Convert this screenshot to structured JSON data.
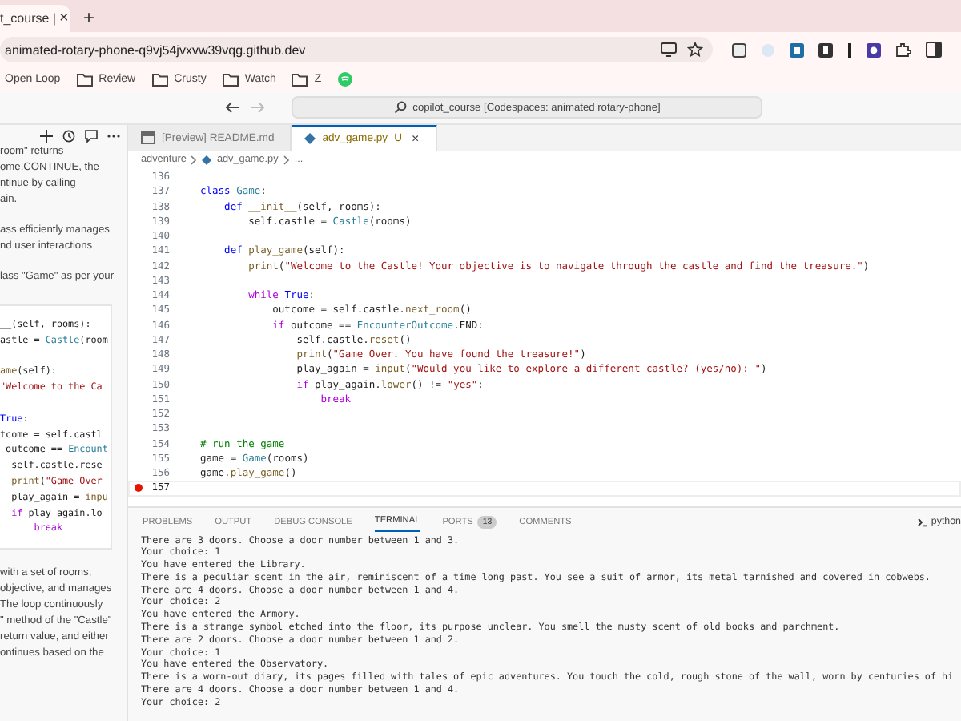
{
  "browser": {
    "tab": {
      "title": "t_course |",
      "close": "×"
    },
    "new_tab": "+",
    "url": "animated-rotary-phone-q9vj54jvxvw39vqg.github.dev",
    "bookmarks": [
      {
        "label": "Open Loop",
        "kind": "link"
      },
      {
        "label": "Review",
        "kind": "folder"
      },
      {
        "label": "Crusty",
        "kind": "folder"
      },
      {
        "label": "Watch",
        "kind": "folder"
      },
      {
        "label": "Z",
        "kind": "folder"
      },
      {
        "kind": "app"
      }
    ]
  },
  "title_bar": {
    "command_center": "copilot_course [Codespaces: animated rotary-phone]"
  },
  "chat": {
    "paragraphs_top": [
      [
        "room\" returns",
        "ome.CONTINUE, the",
        "ntinue by calling",
        "ain."
      ],
      [
        "ass efficiently manages",
        "nd user interactions"
      ],
      [
        "lass \"Game\" as per your"
      ]
    ],
    "code": [
      {
        "kind": "code",
        "tokens": [
          {
            "text": "__(self, rooms):",
            "kind": "plain"
          }
        ]
      },
      {
        "kind": "code",
        "tokens": [
          {
            "text": "astle = ",
            "kind": "plain"
          },
          {
            "text": "Castle",
            "kind": "class"
          },
          {
            "text": "(room",
            "kind": "plain"
          }
        ]
      },
      {
        "kind": "blank"
      },
      {
        "kind": "code",
        "tokens": [
          {
            "text": "ame",
            "kind": "function"
          },
          {
            "text": "(self):",
            "kind": "plain"
          }
        ]
      },
      {
        "kind": "code",
        "tokens": [
          {
            "text": "\"Welcome to the Ca",
            "kind": "string"
          }
        ]
      },
      {
        "kind": "blank"
      },
      {
        "kind": "code",
        "tokens": [
          {
            "text": "True",
            "kind": "keyword"
          },
          {
            "text": ":",
            "kind": "plain"
          }
        ]
      },
      {
        "kind": "code",
        "tokens": [
          {
            "text": "tcome = self.castl",
            "kind": "plain"
          }
        ]
      },
      {
        "kind": "code",
        "tokens": [
          {
            "text": " outcome == ",
            "kind": "plain"
          },
          {
            "text": "Encount",
            "kind": "class"
          }
        ]
      },
      {
        "kind": "code",
        "tokens": [
          {
            "text": "  self.castle.rese",
            "kind": "plain"
          }
        ]
      },
      {
        "kind": "code",
        "tokens": [
          {
            "text": "  print",
            "kind": "function"
          },
          {
            "text": "(",
            "kind": "plain"
          },
          {
            "text": "\"Game Over",
            "kind": "string"
          }
        ]
      },
      {
        "kind": "code",
        "tokens": [
          {
            "text": "  play_again = ",
            "kind": "plain"
          },
          {
            "text": "inpu",
            "kind": "function"
          }
        ]
      },
      {
        "kind": "code",
        "tokens": [
          {
            "text": "  if",
            "kind": "control"
          },
          {
            "text": " play_again.lo",
            "kind": "plain"
          }
        ]
      },
      {
        "kind": "code",
        "tokens": [
          {
            "text": "      break",
            "kind": "control"
          }
        ]
      }
    ],
    "paragraphs_bottom": [
      [
        "with a set of rooms,",
        "objective, and manages",
        "The loop continuously",
        "\" method of the \"Castle\"",
        "return value, and either",
        "ontinues based on the"
      ]
    ]
  },
  "editor": {
    "tabs": [
      {
        "label": "[Preview] README.md",
        "kind": "preview",
        "selected": false
      },
      {
        "label": "adv_game.py",
        "kind": "python",
        "status": "U",
        "close": "×",
        "selected": true
      }
    ],
    "breadcrumb": [
      "adventure",
      "adv_game.py",
      "..."
    ],
    "lines": [
      {
        "number": "136"
      },
      {
        "number": "137",
        "tokens": [
          {
            "text": "class ",
            "kind": "keyword"
          },
          {
            "text": "Game",
            "kind": "class"
          },
          {
            "text": ":",
            "kind": "plain"
          }
        ]
      },
      {
        "number": "138",
        "tokens": [
          {
            "text": "    def ",
            "kind": "keyword"
          },
          {
            "text": "__init__",
            "kind": "function"
          },
          {
            "text": "(self, rooms):",
            "kind": "plain"
          }
        ]
      },
      {
        "number": "139",
        "tokens": [
          {
            "text": "        self.castle = ",
            "kind": "plain"
          },
          {
            "text": "Castle",
            "kind": "class"
          },
          {
            "text": "(rooms)",
            "kind": "plain"
          }
        ]
      },
      {
        "number": "140"
      },
      {
        "number": "141",
        "tokens": [
          {
            "text": "    def ",
            "kind": "keyword"
          },
          {
            "text": "play_game",
            "kind": "function"
          },
          {
            "text": "(self):",
            "kind": "plain"
          }
        ]
      },
      {
        "number": "142",
        "tokens": [
          {
            "text": "        print",
            "kind": "function"
          },
          {
            "text": "(",
            "kind": "plain"
          },
          {
            "text": "\"Welcome to the Castle! Your objective is to navigate through the castle and find the treasure.\"",
            "kind": "string"
          },
          {
            "text": ")",
            "kind": "plain"
          }
        ]
      },
      {
        "number": "143"
      },
      {
        "number": "144",
        "tokens": [
          {
            "text": "        while ",
            "kind": "control"
          },
          {
            "text": "True",
            "kind": "keyword"
          },
          {
            "text": ":",
            "kind": "plain"
          }
        ]
      },
      {
        "number": "145",
        "tokens": [
          {
            "text": "            outcome = self.castle.",
            "kind": "plain"
          },
          {
            "text": "next_room",
            "kind": "function"
          },
          {
            "text": "()",
            "kind": "plain"
          }
        ]
      },
      {
        "number": "146",
        "tokens": [
          {
            "text": "            if ",
            "kind": "control"
          },
          {
            "text": "outcome == ",
            "kind": "plain"
          },
          {
            "text": "EncounterOutcome",
            "kind": "class"
          },
          {
            "text": ".END:",
            "kind": "plain"
          }
        ]
      },
      {
        "number": "147",
        "tokens": [
          {
            "text": "                self.castle.",
            "kind": "plain"
          },
          {
            "text": "reset",
            "kind": "function"
          },
          {
            "text": "()",
            "kind": "plain"
          }
        ]
      },
      {
        "number": "148",
        "tokens": [
          {
            "text": "                print",
            "kind": "function"
          },
          {
            "text": "(",
            "kind": "plain"
          },
          {
            "text": "\"Game Over. You have found the treasure!\"",
            "kind": "string"
          },
          {
            "text": ")",
            "kind": "plain"
          }
        ]
      },
      {
        "number": "149",
        "tokens": [
          {
            "text": "                play_again = ",
            "kind": "plain"
          },
          {
            "text": "input",
            "kind": "function"
          },
          {
            "text": "(",
            "kind": "plain"
          },
          {
            "text": "\"Would you like to explore a different castle? (yes/no): \"",
            "kind": "string"
          },
          {
            "text": ")",
            "kind": "plain"
          }
        ]
      },
      {
        "number": "150",
        "tokens": [
          {
            "text": "                if ",
            "kind": "control"
          },
          {
            "text": "play_again.",
            "kind": "plain"
          },
          {
            "text": "lower",
            "kind": "function"
          },
          {
            "text": "() != ",
            "kind": "plain"
          },
          {
            "text": "\"yes\"",
            "kind": "string"
          },
          {
            "text": ":",
            "kind": "plain"
          }
        ]
      },
      {
        "number": "151",
        "tokens": [
          {
            "text": "                    break",
            "kind": "control"
          }
        ]
      },
      {
        "number": "152"
      },
      {
        "number": "153"
      },
      {
        "number": "154",
        "tokens": [
          {
            "text": "# run the game",
            "kind": "comment"
          }
        ]
      },
      {
        "number": "155",
        "tokens": [
          {
            "text": "game = ",
            "kind": "plain"
          },
          {
            "text": "Game",
            "kind": "class"
          },
          {
            "text": "(rooms)",
            "kind": "plain"
          }
        ]
      },
      {
        "number": "156",
        "tokens": [
          {
            "text": "game.",
            "kind": "plain"
          },
          {
            "text": "play_game",
            "kind": "function"
          },
          {
            "text": "()",
            "kind": "plain"
          }
        ]
      },
      {
        "number": "157",
        "breakpoint": true,
        "current": true
      }
    ]
  },
  "panel": {
    "tabs": [
      {
        "label": "PROBLEMS",
        "selected": false
      },
      {
        "label": "OUTPUT",
        "selected": false
      },
      {
        "label": "DEBUG CONSOLE",
        "selected": false
      },
      {
        "label": "TERMINAL",
        "selected": true
      },
      {
        "label": "PORTS",
        "badge": "13",
        "selected": false
      },
      {
        "label": "COMMENTS",
        "selected": false
      }
    ],
    "terminal_name": "python",
    "terminal_lines": [
      "There are 3 doors. Choose a door number between 1 and 3.",
      "Your choice: 1",
      "You have entered the Library.",
      "There is a peculiar scent in the air, reminiscent of a time long past. You see a suit of armor, its metal tarnished and covered in cobwebs.",
      "There are 4 doors. Choose a door number between 1 and 4.",
      "Your choice: 2",
      "You have entered the Armory.",
      "There is a strange symbol etched into the floor, its purpose unclear. You smell the musty scent of old books and parchment.",
      "There are 2 doors. Choose a door number between 1 and 2.",
      "Your choice: 1",
      "You have entered the Observatory.",
      "There is a worn-out diary, its pages filled with tales of epic adventures. You touch the cold, rough stone of the wall, worn by centuries of hi",
      "There are 4 doors. Choose a door number between 1 and 4.",
      "Your choice: 2"
    ]
  }
}
